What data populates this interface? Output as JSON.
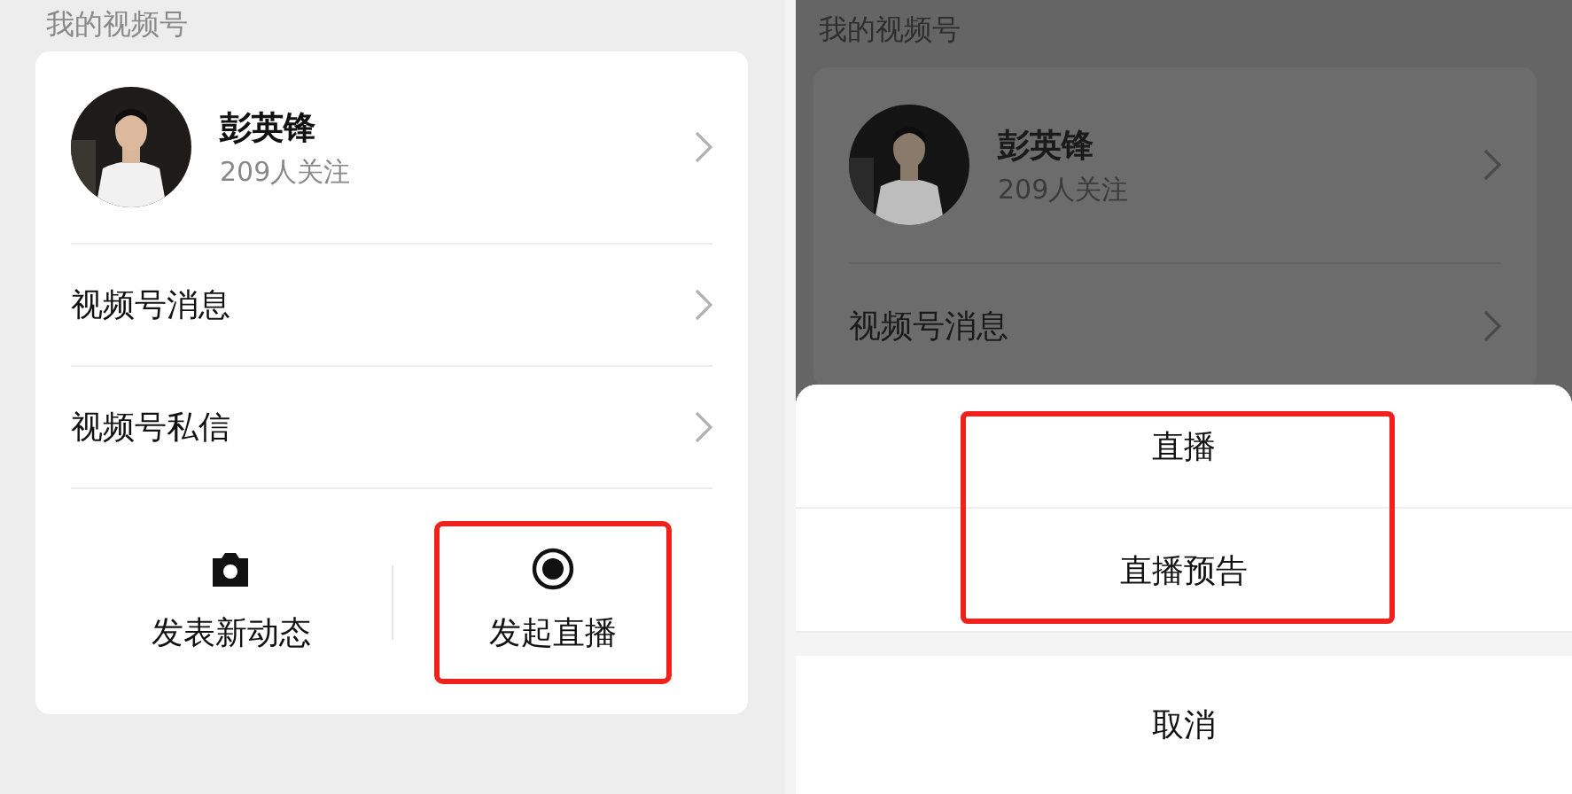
{
  "left": {
    "section_title": "我的视频号",
    "profile": {
      "name": "彭英锋",
      "followers": "209人关注"
    },
    "menu": [
      {
        "label": "视频号消息"
      },
      {
        "label": "视频号私信"
      }
    ],
    "actions": [
      {
        "kind": "camera",
        "label": "发表新动态",
        "highlighted": false
      },
      {
        "kind": "live",
        "label": "发起直播",
        "highlighted": true
      }
    ]
  },
  "right": {
    "section_title": "我的视频号",
    "profile": {
      "name": "彭英锋",
      "followers": "209人关注"
    },
    "menu": [
      {
        "label": "视频号消息"
      }
    ],
    "sheet": {
      "options": [
        {
          "label": "直播",
          "highlighted": true
        },
        {
          "label": "直播预告",
          "highlighted": true
        }
      ],
      "cancel": "取消"
    }
  }
}
